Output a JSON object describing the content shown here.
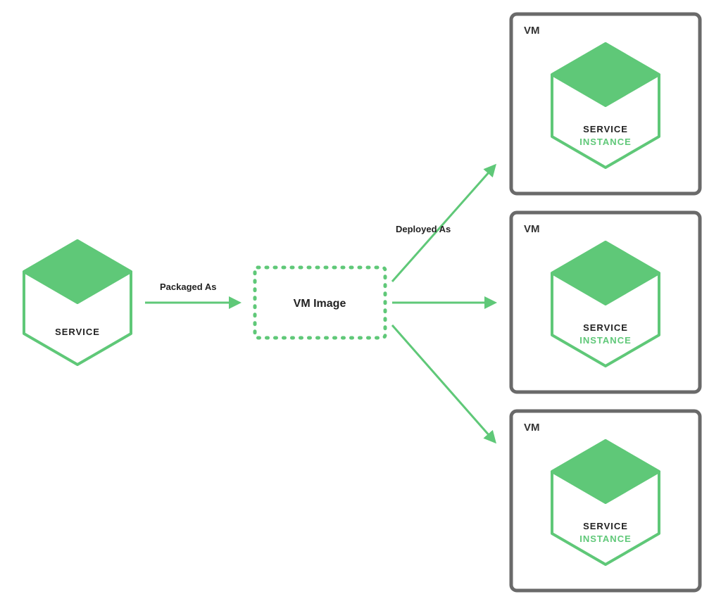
{
  "diagram": {
    "service": {
      "label": "SERVICE"
    },
    "vm_image": {
      "label": "VM Image"
    },
    "instances": [
      {
        "box_label": "VM",
        "line1": "SERVICE",
        "line2": "INSTANCE"
      },
      {
        "box_label": "VM",
        "line1": "SERVICE",
        "line2": "INSTANCE"
      },
      {
        "box_label": "VM",
        "line1": "SERVICE",
        "line2": "INSTANCE"
      }
    ],
    "edges": {
      "packaged_as": "Packaged As",
      "deployed_as": "Deployed As"
    }
  },
  "colors": {
    "green": "#5fc878",
    "grey": "#6a6a6a",
    "text": "#222222"
  }
}
